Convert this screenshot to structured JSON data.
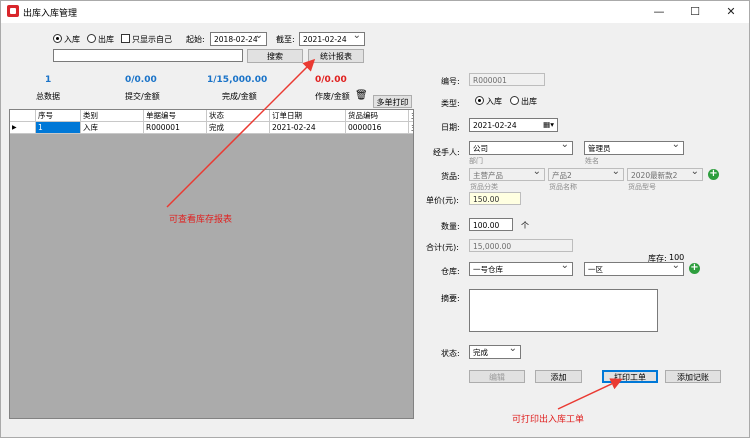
{
  "window": {
    "title": "出库入库管理",
    "min": "—",
    "max": "☐",
    "close": "✕"
  },
  "filter": {
    "radio_in": "入库",
    "radio_out": "出库",
    "only_self": "只显示自己",
    "start_label": "起始:",
    "start_value": "2018-02-24",
    "end_label": "截至:",
    "end_value": "2021-02-24",
    "search_value": "",
    "search_btn": "搜索",
    "report_btn": "统计报表"
  },
  "stats": [
    {
      "value": "1",
      "label": "总数据"
    },
    {
      "value": "0/0.00",
      "label": "提交/金额"
    },
    {
      "value": "1/15,000.00",
      "label": "完成/金额"
    },
    {
      "value": "0/0.00",
      "label": "作废/金额"
    }
  ],
  "multi_print_btn": "多单打印",
  "table": {
    "columns": [
      "",
      "序号",
      "类别",
      "单据编号",
      "状态",
      "订单日期",
      "货品编码",
      "主"
    ],
    "rows": [
      [
        "▶",
        "1",
        "入库",
        "R000001",
        "完成",
        "2021-02-24",
        "0000016",
        "主"
      ]
    ]
  },
  "form": {
    "code_label": "编号:",
    "code_value": "R000001",
    "type_label": "类型:",
    "type_in": "入库",
    "type_out": "出库",
    "date_label": "日期:",
    "date_value": "2021-02-24",
    "handler_label": "经手人:",
    "dept_value": "公司",
    "dept_sub": "部门",
    "name_value": "管理员",
    "name_sub": "姓名",
    "goods_label": "货品:",
    "goods_cat": "主营产品",
    "goods_cat_sub": "货品分类",
    "goods_name": "产品2",
    "goods_name_sub": "货品名称",
    "goods_model": "2020最新款2",
    "goods_model_sub": "货品型号",
    "price_label": "单价(元):",
    "price_value": "150.00",
    "qty_label": "数量:",
    "qty_value": "100.00",
    "qty_unit": "个",
    "total_label": "合计(元):",
    "total_value": "15,000.00",
    "stock_label": "库存:",
    "stock_value": "100",
    "warehouse_label": "仓库:",
    "warehouse_value": "一号仓库",
    "area_value": "一区",
    "remark_label": "摘要:",
    "remark_value": "",
    "status_label": "状态:",
    "status_value": "完成",
    "edit_btn": "编辑",
    "add_btn": "添加",
    "print_btn": "打印工单",
    "add_record_btn": "添加记账"
  },
  "annotations": {
    "report_note": "可查看库存报表",
    "print_note": "可打印出入库工单"
  },
  "colors": {
    "accent_blue": "#1a73c8",
    "accent_red": "#e0201f",
    "arrow_red": "#ea3a32"
  }
}
